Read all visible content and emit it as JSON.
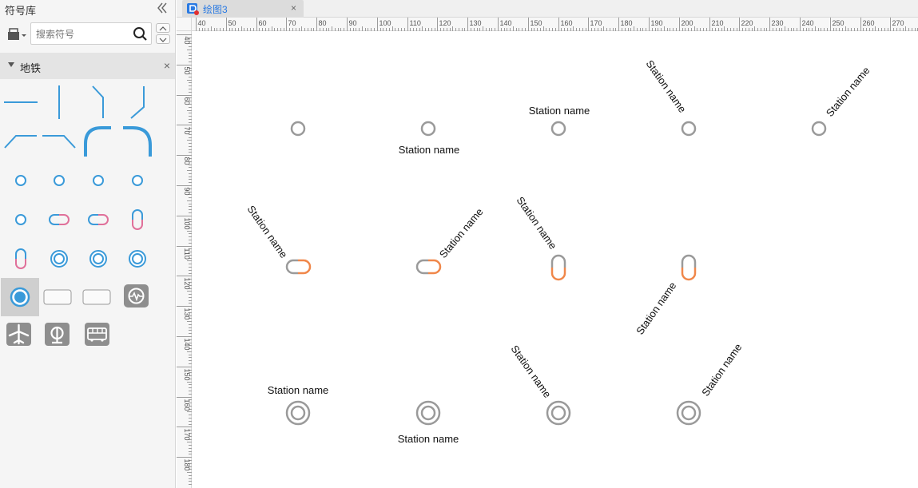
{
  "sidebar": {
    "title": "符号库",
    "search": {
      "placeholder": "搜索符号",
      "value": ""
    },
    "section": {
      "title": "地铁",
      "close_glyph": "×"
    }
  },
  "palette_icons": [
    "line-horizontal",
    "line-vertical",
    "line-bend-down",
    "line-bend-up",
    "line-bend-left",
    "line-bend-right",
    "line-curve-left",
    "line-curve-right",
    "station-circle",
    "station-circle",
    "station-circle",
    "station-circle",
    "station-circle",
    "transfer-pill-horizontal",
    "transfer-pill-horizontal",
    "transfer-pill-vertical",
    "transfer-pill-vertical",
    "interchange-ring",
    "interchange-ring",
    "interchange-ring",
    "interchange-ring-selected",
    "rounded-rect",
    "rounded-rect",
    "metro-logo-icon",
    "airport-icon",
    "railway-icon",
    "bus-icon"
  ],
  "tabs": [
    {
      "label": "绘图3",
      "close_glyph": "×"
    }
  ],
  "ruler": {
    "h_labels": [
      "40",
      "50",
      "60",
      "70",
      "80",
      "90",
      "100",
      "110",
      "120",
      "130",
      "140",
      "150",
      "160",
      "170",
      "180",
      "190",
      "200",
      "210",
      "220",
      "230",
      "240",
      "250",
      "260",
      "270"
    ],
    "v_labels": [
      "40",
      "50",
      "60",
      "70",
      "80",
      "90",
      "100",
      "110",
      "120",
      "130",
      "140",
      "150",
      "160",
      "170",
      "180"
    ]
  },
  "canvas": {
    "station_label": "Station name",
    "colors": {
      "station_stroke": "#9a9a9a",
      "transfer_accent": "#f0874a",
      "palette_blue": "#3a9ad9",
      "palette_pink": "#e0709a"
    }
  }
}
